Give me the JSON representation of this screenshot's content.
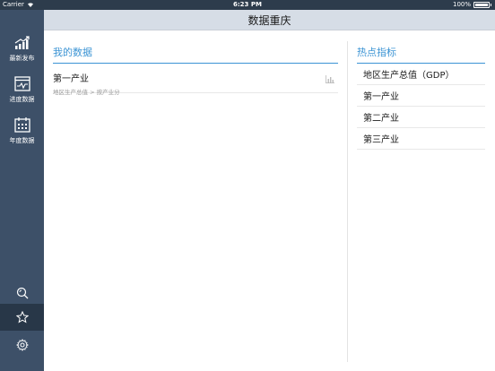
{
  "status_bar": {
    "carrier": "Carrier",
    "time": "6:23 PM",
    "battery": "100%"
  },
  "header": {
    "title": "数据重庆"
  },
  "sidebar": {
    "items": [
      {
        "label": "最新发布",
        "icon": "new-release-icon"
      },
      {
        "label": "进度数据",
        "icon": "progress-chart-icon"
      },
      {
        "label": "年度数据",
        "icon": "calendar-icon"
      }
    ],
    "bottom": [
      {
        "icon": "search-icon"
      },
      {
        "icon": "star-icon",
        "active": true
      },
      {
        "icon": "gear-icon"
      }
    ]
  },
  "my_data": {
    "title": "我的数据",
    "items": [
      {
        "name": "第一产业",
        "path": "地区生产总值 > 按产业分"
      }
    ]
  },
  "hot_indicators": {
    "title": "热点指标",
    "items": [
      {
        "label": "地区生产总值（GDP）"
      },
      {
        "label": "第一产业"
      },
      {
        "label": "第二产业"
      },
      {
        "label": "第三产业"
      }
    ]
  },
  "colors": {
    "sidebar": "#3d5068",
    "sidebar_active": "#283748",
    "header": "#d6dde6",
    "accent": "#3c94d4"
  }
}
